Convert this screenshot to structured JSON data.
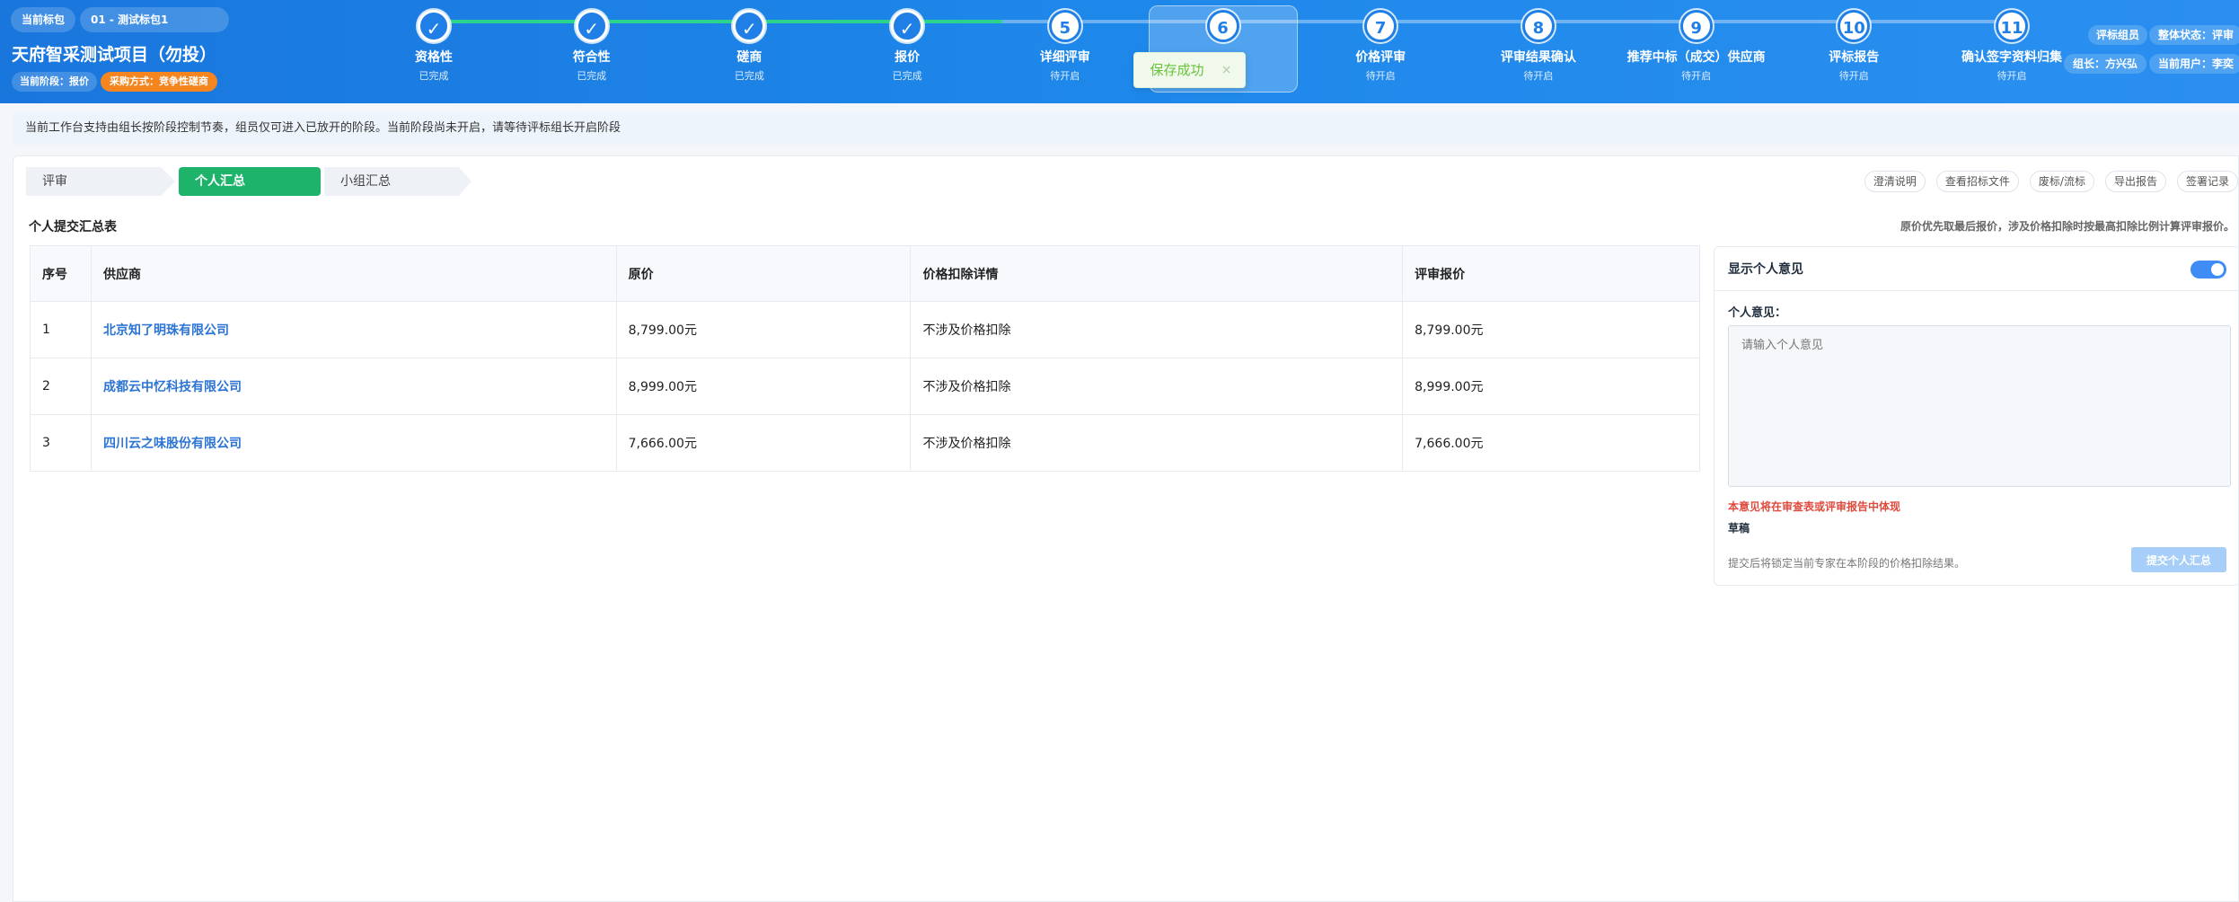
{
  "header": {
    "current_package_label": "当前标包",
    "package_name": "01 - 测试标包1",
    "project_title": "天府智采测试项目（勿投）",
    "current_stage": "当前阶段：报价",
    "procurement_method": "采购方式：竞争性磋商",
    "steps": [
      {
        "label": "资格性",
        "status": "已完成",
        "mark": "✓",
        "done": true
      },
      {
        "label": "符合性",
        "status": "已完成",
        "mark": "✓",
        "done": true
      },
      {
        "label": "磋商",
        "status": "已完成",
        "mark": "✓",
        "done": true
      },
      {
        "label": "报价",
        "status": "已完成",
        "mark": "✓",
        "done": true
      },
      {
        "label": "详细评审",
        "status": "待开启",
        "mark": "5",
        "done": false
      },
      {
        "label": "",
        "status": "",
        "mark": "6",
        "done": false
      },
      {
        "label": "价格评审",
        "status": "待开启",
        "mark": "7",
        "done": false
      },
      {
        "label": "评审结果确认",
        "status": "待开启",
        "mark": "8",
        "done": false
      },
      {
        "label": "推荐中标（成交）供应商",
        "status": "待开启",
        "mark": "9",
        "done": false
      },
      {
        "label": "评标报告",
        "status": "待开启",
        "mark": "10",
        "done": false
      },
      {
        "label": "确认签字资料归集",
        "status": "待开启",
        "mark": "11",
        "done": false
      }
    ],
    "role": "评标组员",
    "overall_status": "整体状态：评审",
    "leader": "组长：方兴弘",
    "current_user": "当前用户：李奕"
  },
  "toast": {
    "message": "保存成功",
    "close": "×"
  },
  "notice": "当前工作台支持由组长按阶段控制节奏，组员仅可进入已放开的阶段。当前阶段尚未开启，请等待评标组长开启阶段",
  "tabs": {
    "review": "评审",
    "personal": "个人汇总",
    "group": "小组汇总"
  },
  "tools": [
    "澄清说明",
    "查看招标文件",
    "废标/流标",
    "导出报告",
    "签署记录"
  ],
  "section": {
    "title": "个人提交汇总表",
    "note": "原价优先取最后报价，涉及价格扣除时按最高扣除比例计算评审报价。"
  },
  "table": {
    "headers": [
      "序号",
      "供应商",
      "原价",
      "价格扣除详情",
      "评审报价"
    ],
    "rows": [
      {
        "no": "1",
        "supplier": "北京知了明珠有限公司",
        "price": "8,799.00元",
        "deduction": "不涉及价格扣除",
        "review_price": "8,799.00元"
      },
      {
        "no": "2",
        "supplier": "成都云中忆科技有限公司",
        "price": "8,999.00元",
        "deduction": "不涉及价格扣除",
        "review_price": "8,999.00元"
      },
      {
        "no": "3",
        "supplier": "四川云之味股份有限公司",
        "price": "7,666.00元",
        "deduction": "不涉及价格扣除",
        "review_price": "7,666.00元"
      }
    ]
  },
  "side": {
    "title": "显示个人意见",
    "toggle_on": true,
    "label": "个人意见：",
    "placeholder": "请输入个人意见",
    "warning": "本意见将在审查表或评审报告中体现",
    "draft": "草稿",
    "submit_note": "提交后将锁定当前专家在本阶段的价格扣除结果。",
    "submit_button": "提交个人汇总"
  },
  "colors": {
    "header": "#1e88ea",
    "accent_green": "#1db36b",
    "link": "#2b74d4",
    "warning": "#e04a3e",
    "orange": "#f5861f"
  }
}
